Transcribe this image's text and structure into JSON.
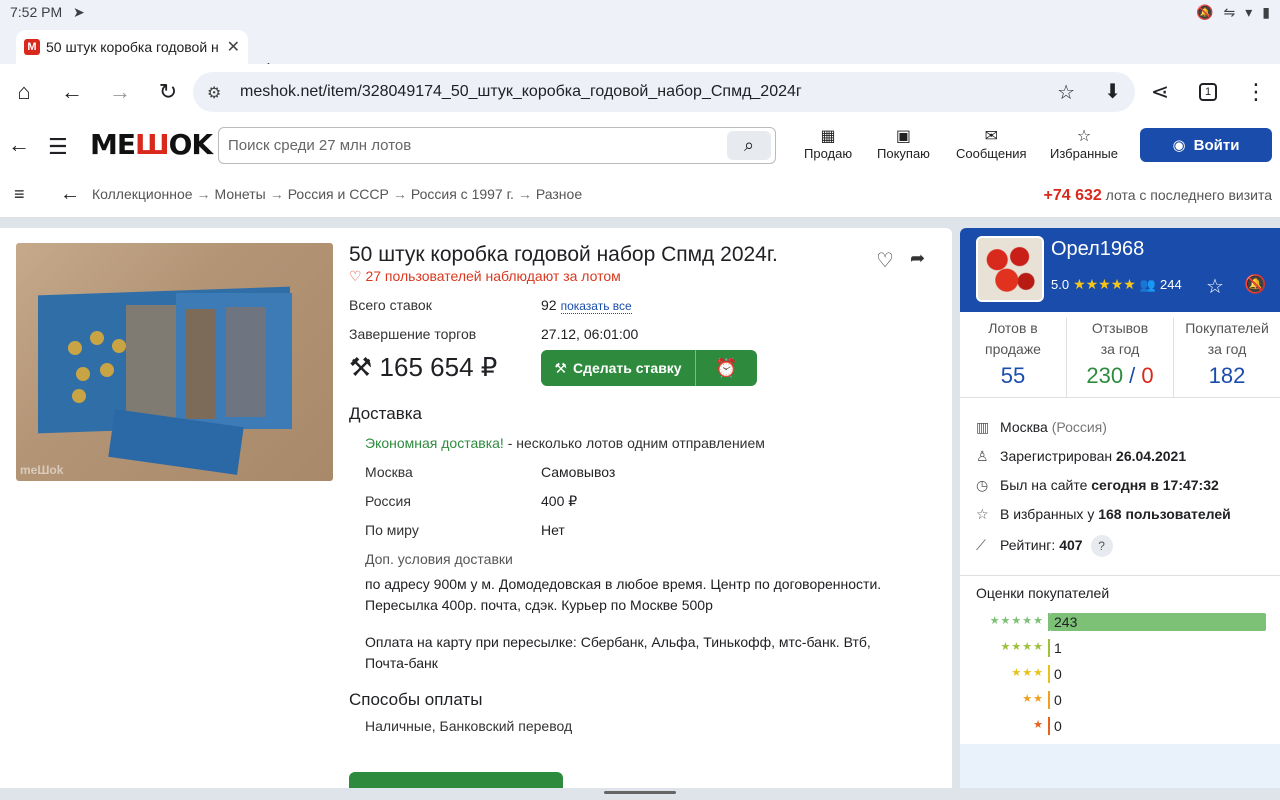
{
  "status": {
    "time": "7:52 PM"
  },
  "tab": {
    "title": "50 штук коробка годовой н",
    "favicon": "M"
  },
  "omnibox": {
    "url": "meshok.net/item/328049174_50_штук_коробка_годовой_набор_Спмд_2024г",
    "tab_count": "1"
  },
  "header": {
    "logo_pre": "ME",
    "logo_w": "Ш",
    "logo_post": "OK",
    "search_placeholder": "Поиск среди 27 млн лотов",
    "nav": [
      "Продаю",
      "Покупаю",
      "Сообщения",
      "Избранные"
    ],
    "login": "Войти"
  },
  "breadcrumbs": {
    "items": [
      "Коллекционное",
      "Монеты",
      "Россия и СССР",
      "Россия с 1997 г.",
      "Разное"
    ],
    "visits_count": "+74 632",
    "visits_text": " лота с последнего визита"
  },
  "item": {
    "title": "50 штук коробка годовой набор Спмд 2024г.",
    "watchers": "27 пользователей наблюдают за лотом",
    "bids_label": "Всего ставок",
    "bids_value": "92",
    "show_all": "показать все",
    "end_label": "Завершение торгов",
    "end_value": "27.12, 06:01:00",
    "price": "165 654 ₽",
    "bid_button": "Сделать ставку",
    "photo_watermark": "meШok"
  },
  "delivery": {
    "heading": "Доставка",
    "economy": "Экономная доставка!",
    "economy_text": " - несколько лотов одним отправлением",
    "rows": [
      {
        "label": "Москва",
        "value": "Самовывоз"
      },
      {
        "label": "Россия",
        "value": "400 ₽"
      },
      {
        "label": "По миру",
        "value": "Нет"
      }
    ],
    "extra_label": "Доп. условия доставки",
    "extra_text": "по адресу 900м у м. Домодедовская в любое время. Центр по договоренности. Пересылка 400р. почта, сдэк. Курьер по Москве 500р",
    "payment_note": "Оплата на карту при пересылке: Сбербанк, Альфа, Тинькофф, мтс-банк. Втб, Почта-банк"
  },
  "payment": {
    "heading": "Способы оплаты",
    "methods": "Наличные, Банковский перевод"
  },
  "seller": {
    "name": "Орел1968",
    "rating": "5.0",
    "stars": "★★★★★",
    "reviews_count": "244",
    "stats": [
      {
        "label1": "Лотов в",
        "label2": "продаже",
        "value": "55"
      },
      {
        "label1": "Отзывов",
        "label2": "за год",
        "pos": "230",
        "sep": " / ",
        "neg": "0"
      },
      {
        "label1": "Покупателей",
        "label2": "за год",
        "value": "182"
      }
    ],
    "city": "Москва",
    "country": "(Россия)",
    "registered_label": "Зарегистрирован ",
    "registered": "26.04.2021",
    "seen_label": "Был на сайте ",
    "seen": "сегодня в 17:47:32",
    "fav_label": "В избранных у ",
    "fav": "168 пользователей",
    "rating_label": "Рейтинг: ",
    "rating_value": "407",
    "help": "?",
    "ratings_title": "Оценки покупателей",
    "ratings": [
      {
        "stars": "★★★★★",
        "count": "243",
        "fill": 1.0,
        "color": "#7cc176"
      },
      {
        "stars": "★★★★",
        "count": "1",
        "fill": 0,
        "color": "#9cc23a"
      },
      {
        "stars": "★★★",
        "count": "0",
        "fill": 0,
        "color": "#e6c21a"
      },
      {
        "stars": "★★",
        "count": "0",
        "fill": 0,
        "color": "#f0a020"
      },
      {
        "stars": "★",
        "count": "0",
        "fill": 0,
        "color": "#e8601c"
      }
    ]
  },
  "colors": {
    "brand": "#1a4dab",
    "accent_red": "#d9281c",
    "green": "#2e8b3e"
  }
}
